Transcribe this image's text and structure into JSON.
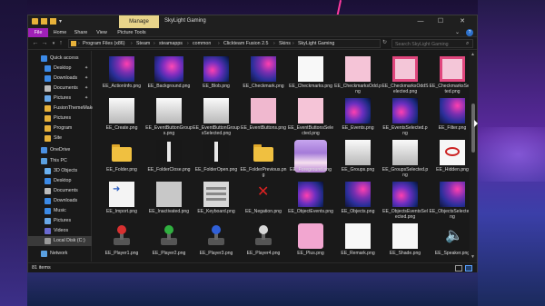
{
  "window": {
    "title": "SkyLight Gaming",
    "manage_tab": "Manage",
    "controls": {
      "minimize": "—",
      "maximize": "☐",
      "close": "✕"
    }
  },
  "ribbon": {
    "tabs": [
      "File",
      "Home",
      "Share",
      "View",
      "Picture Tools"
    ],
    "help": "?"
  },
  "address": {
    "crumbs": [
      "Program Files (x86)",
      "Steam",
      "steamapps",
      "common",
      "Clickteam Fusion 2.5",
      "Skins",
      "SkyLight Gaming"
    ],
    "search_placeholder": "Search SkyLight Gaming"
  },
  "sidebar": {
    "items": [
      {
        "label": "Quick access",
        "icon": "star-icon",
        "color": "#3c8ae6",
        "pinned": false
      },
      {
        "label": "Desktop",
        "icon": "desktop-icon",
        "color": "#3c8ae6",
        "pinned": true
      },
      {
        "label": "Downloads",
        "icon": "download-icon",
        "color": "#3c8ae6",
        "pinned": true
      },
      {
        "label": "Documents",
        "icon": "document-icon",
        "color": "#bcbcbc",
        "pinned": true
      },
      {
        "label": "Pictures",
        "icon": "picture-icon",
        "color": "#6aa8e8",
        "pinned": true
      },
      {
        "label": "FusionThemeMaker",
        "icon": "folder-icon",
        "color": "#e8b23a",
        "pinned": false
      },
      {
        "label": "Pictures",
        "icon": "folder-icon",
        "color": "#e8b23a",
        "pinned": false
      },
      {
        "label": "Program",
        "icon": "folder-icon",
        "color": "#e8b23a",
        "pinned": false
      },
      {
        "label": "Site",
        "icon": "folder-icon",
        "color": "#e8b23a",
        "pinned": false
      },
      {
        "label": "OneDrive",
        "icon": "cloud-icon",
        "color": "#4a90e2",
        "pinned": false
      },
      {
        "label": "This PC",
        "icon": "computer-icon",
        "color": "#5aa0e0",
        "pinned": false
      },
      {
        "label": "3D Objects",
        "icon": "cube-icon",
        "color": "#6ab0f0",
        "pinned": false
      },
      {
        "label": "Desktop",
        "icon": "desktop-icon",
        "color": "#3c8ae6",
        "pinned": false
      },
      {
        "label": "Documents",
        "icon": "document-icon",
        "color": "#bcbcbc",
        "pinned": false
      },
      {
        "label": "Downloads",
        "icon": "download-icon",
        "color": "#3c8ae6",
        "pinned": false
      },
      {
        "label": "Music",
        "icon": "music-icon",
        "color": "#3c8ae6",
        "pinned": false
      },
      {
        "label": "Pictures",
        "icon": "picture-icon",
        "color": "#6aa8e8",
        "pinned": false
      },
      {
        "label": "Videos",
        "icon": "video-icon",
        "color": "#6a6ad0",
        "pinned": false
      },
      {
        "label": "Local Disk (C:)",
        "icon": "drive-icon",
        "color": "#9a9a9a",
        "pinned": false
      },
      {
        "label": "Network",
        "icon": "network-icon",
        "color": "#5aa0e0",
        "pinned": false
      }
    ]
  },
  "files": [
    {
      "label": "EE_ActionInfo.png",
      "kind": "galaxy"
    },
    {
      "label": "EE_Background.png",
      "kind": "bigbg"
    },
    {
      "label": "EE_Blob.png",
      "kind": "galaxy2"
    },
    {
      "label": "EE_Checkmark.png",
      "kind": "galaxy"
    },
    {
      "label": "EE_Checkmarks.png",
      "kind": "white"
    },
    {
      "label": "EE_CheckmarksOdd.png",
      "kind": "pinks"
    },
    {
      "label": "EE_CheckmarksOddSelected.png",
      "kind": "pinkb"
    },
    {
      "label": "EE_CheckmarksSelected.png",
      "kind": "pinkb"
    },
    {
      "label": "EE_Create.png",
      "kind": "grad"
    },
    {
      "label": "EE_EventButtonGroups.png",
      "kind": "grad"
    },
    {
      "label": "EE_EventButtonGroupsSelected.png",
      "kind": "grad"
    },
    {
      "label": "EE_EventButtons.png",
      "kind": "pink"
    },
    {
      "label": "EE_EventButtonsSelected.png",
      "kind": "pinks"
    },
    {
      "label": "EE_Events.png",
      "kind": "galaxy2"
    },
    {
      "label": "EE_EventsSelected.png",
      "kind": "galaxy2"
    },
    {
      "label": "EE_Filter.png",
      "kind": "galaxy"
    },
    {
      "label": "EE_Folder.png",
      "kind": "folder"
    },
    {
      "label": "EE_FolderClose.png",
      "kind": "dark"
    },
    {
      "label": "EE_FolderOpen.png",
      "kind": "dark"
    },
    {
      "label": "EE_FolderPrevious.png",
      "kind": "folder"
    },
    {
      "label": "EE_Foreground.png",
      "kind": "chara"
    },
    {
      "label": "EE_Groups.png",
      "kind": "grad"
    },
    {
      "label": "EE_GroupsSelected.png",
      "kind": "grad"
    },
    {
      "label": "EE_Hidden.png",
      "kind": "eye"
    },
    {
      "label": "EE_Import.png",
      "kind": "import"
    },
    {
      "label": "EE_Inactivated.png",
      "kind": "gray"
    },
    {
      "label": "EE_Keyboard.png",
      "kind": "keyboard"
    },
    {
      "label": "EE_Negation.png",
      "kind": "x"
    },
    {
      "label": "EE_ObjectEvents.png",
      "kind": "galaxy2"
    },
    {
      "label": "EE_Objects.png",
      "kind": "galaxy"
    },
    {
      "label": "EE_ObjectsEventsSelected.png",
      "kind": "galaxy2"
    },
    {
      "label": "EE_ObjectsSelected.png",
      "kind": "galaxy"
    },
    {
      "label": "EE_Player1.png",
      "kind": "player",
      "ball": "#d83030"
    },
    {
      "label": "EE_Player2.png",
      "kind": "player",
      "ball": "#30b040"
    },
    {
      "label": "EE_Player3.png",
      "kind": "player",
      "ball": "#3060d8"
    },
    {
      "label": "EE_Player4.png",
      "kind": "player",
      "ball": "#d8d8d8"
    },
    {
      "label": "EE_Plus.png",
      "kind": "plus"
    },
    {
      "label": "EE_Remark.png",
      "kind": "white"
    },
    {
      "label": "EE_Shade.png",
      "kind": "white"
    },
    {
      "label": "EE_Speaker.png",
      "kind": "speaker"
    }
  ],
  "status": {
    "count": "81 items"
  }
}
